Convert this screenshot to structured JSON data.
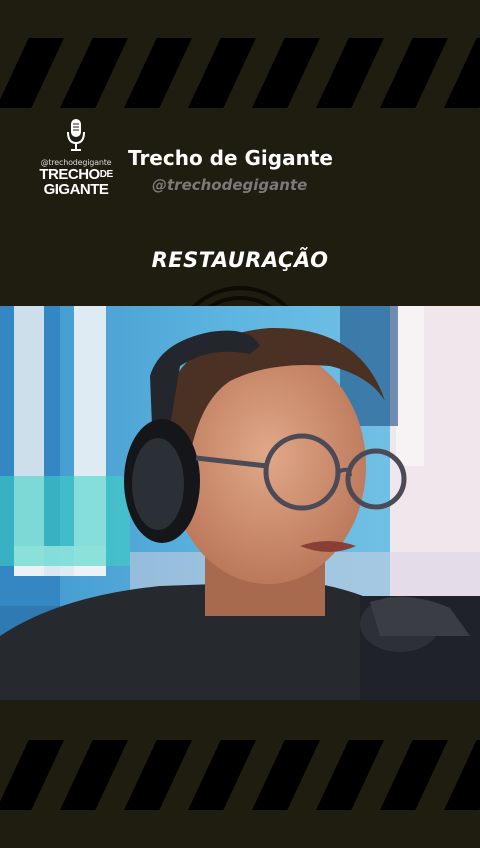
{
  "header": {
    "logo": {
      "handle": "@trechodegigante",
      "line1": "TRECHO",
      "line1_small": "DE",
      "line2": "GIGANTE",
      "icon": "microphone-icon"
    },
    "channel_name": "Trecho de Gigante",
    "channel_handle": "@trechodegigante"
  },
  "episode": {
    "title": "RESTAURAÇÃO"
  },
  "video": {
    "subject": "podcast-host-with-headphones-and-glasses"
  },
  "colors": {
    "background": "#1f1d0f",
    "stripe": "#000000",
    "text": "#ffffff",
    "handle": "#7a7a7a"
  }
}
